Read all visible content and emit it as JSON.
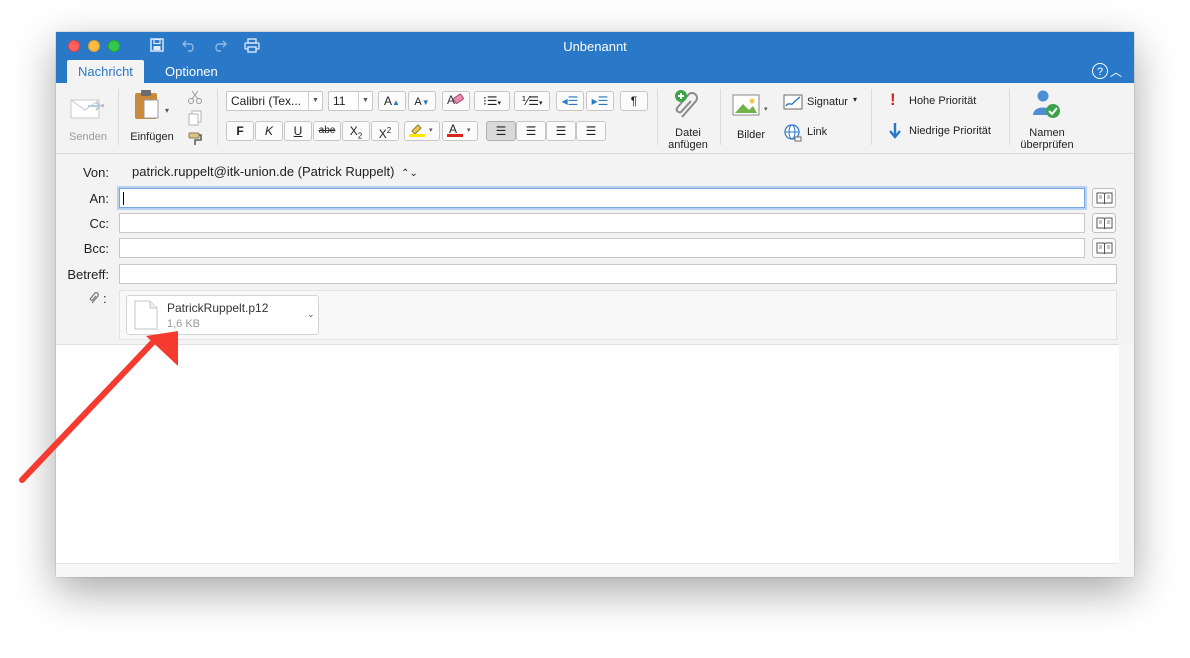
{
  "window": {
    "title": "Unbenannt"
  },
  "quick_access": {
    "save_icon": "save-icon",
    "undo_icon": "undo-icon",
    "redo_icon": "redo-icon",
    "print_icon": "print-icon"
  },
  "tabs": [
    {
      "label": "Nachricht",
      "active": true
    },
    {
      "label": "Optionen",
      "active": false
    }
  ],
  "ribbon": {
    "send_label": "Senden",
    "paste_label": "Einfügen",
    "font_name": "Calibri (Tex...",
    "font_size": "11",
    "bold": "F",
    "italic": "K",
    "underline": "U",
    "strike": "abe",
    "pilcrow": "¶",
    "attach_label_line1": "Datei",
    "attach_label_line2": "anfügen",
    "pictures_label": "Bilder",
    "signature_label": "Signatur",
    "link_label": "Link",
    "high_priority_label": "Hohe Priorität",
    "low_priority_label": "Niedrige Priorität",
    "check_names_line1": "Namen",
    "check_names_line2": "überprüfen"
  },
  "fields": {
    "from_label": "Von:",
    "from_value": "patrick.ruppelt@itk-union.de (Patrick Ruppelt)",
    "to_label": "An:",
    "cc_label": "Cc:",
    "bcc_label": "Bcc:",
    "subject_label": "Betreff:",
    "attach_label": ":"
  },
  "attachment": {
    "name": "PatrickRuppelt.p12",
    "size": "1,6 KB"
  },
  "colors": {
    "accent": "#2a78c8",
    "annotation_arrow": "#f53b2f",
    "highlight": "#ffe600",
    "font_color": "#d9261c"
  }
}
